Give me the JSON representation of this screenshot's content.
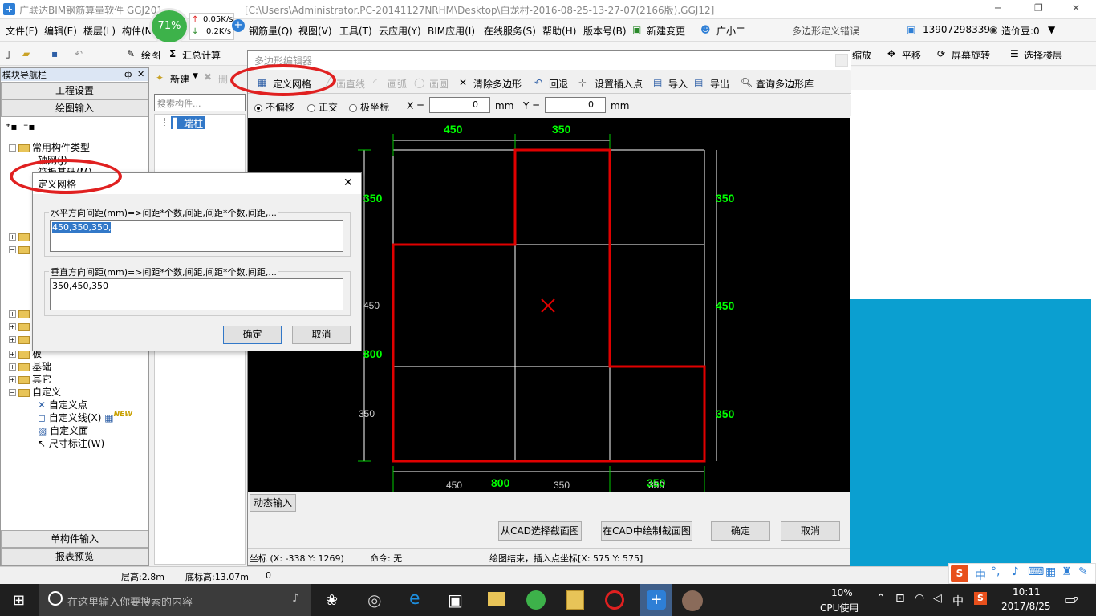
{
  "window": {
    "title": "广联达BIM钢筋算量软件 GGJ2013 - [C:\\Users\\Administrator.PC-20141127NRHM\\Desktop\\白龙村-2016-08-25-13-27-07(2166版).GGJ12]",
    "title_prefix": "广联达BIM钢筋算量软件 GGJ201",
    "title_suffix": "[C:\\Users\\Administrator.PC-20141127NRHM\\Desktop\\白龙村-2016-08-25-13-27-07(2166版).GGJ12]",
    "minimize": "─",
    "restore": "❐",
    "close": "✕"
  },
  "net_widget": {
    "percent": "71%",
    "up": "0.05K/s",
    "down": "0.2K/s"
  },
  "menu": {
    "file": "文件(F)",
    "edit": "编辑(E)",
    "floor": "楼层(L)",
    "component": "构件(N",
    "rebar": "钢筋量(Q)",
    "view": "视图(V)",
    "tools": "工具(T)",
    "cloud": "云应用(Y)",
    "bim": "BIM应用(I)",
    "online": "在线服务(S)",
    "help": "帮助(H)",
    "version": "版本号(B)",
    "new_change": "新建变更",
    "assistant": "广小二",
    "error_label": "多边形定义错误",
    "phone": "13907298339",
    "price": "造价豆:0"
  },
  "toolbar": {
    "draw": "绘图",
    "sum": "汇总计算",
    "zoom": "缩放",
    "pan": "平移",
    "rotate": "屏幕旋转",
    "select_floor": "选择楼层"
  },
  "nav": {
    "header": "模块导航栏",
    "pin": "ф",
    "close": "✕",
    "project_settings": "工程设置",
    "draw_input": "绘图输入",
    "tree": {
      "common_types": "常用构件类型",
      "item_a": "轴网(J)",
      "item_b": "筏板基础(M)",
      "plate": "板",
      "foundation": "基础",
      "other": "其它",
      "custom": "自定义",
      "custom_point": "自定义点",
      "custom_line": "自定义线(X)",
      "new_badge": "NEW",
      "custom_face": "自定义面",
      "dimension": "尺寸标注(W)"
    },
    "single_input": "单构件输入",
    "report_preview": "报表预览"
  },
  "mid": {
    "new": "新建",
    "delete": "删",
    "search_placeholder": "搜索构件...",
    "selected_item": "端柱"
  },
  "editor": {
    "title": "多边形编辑器",
    "tools": {
      "define_grid": "定义网格",
      "draw_line": "画直线",
      "draw_arc": "画弧",
      "draw_circle": "画圆",
      "clear_polygon": "清除多边形",
      "undo": "回退",
      "set_insert_point": "设置插入点",
      "import": "导入",
      "export": "导出",
      "query_library": "查询多边形库"
    },
    "options": {
      "no_offset": "不偏移",
      "orthogonal": "正交",
      "polar": "极坐标",
      "x_label": "X =",
      "x_value": "0",
      "y_label": "Y =",
      "y_value": "0",
      "unit": "mm"
    },
    "dims": {
      "top_450": "450",
      "top_350": "350",
      "left_350": "350",
      "left_450": "450",
      "left_800": "800",
      "left_350b": "350",
      "right_350": "350",
      "right_450": "450",
      "right_350b": "350",
      "bottom_450": "450",
      "bottom_800": "800",
      "bottom_350": "350",
      "bottom_350g": "350",
      "bottom_350w": "350"
    },
    "dynamic_input": "动态输入",
    "btn_select_cad": "从CAD选择截面图",
    "btn_draw_cad": "在CAD中绘制截面图",
    "btn_ok": "确定",
    "btn_cancel": "取消",
    "status": {
      "coords": "坐标 (X: -338 Y: 1269)",
      "command": "命令: 无",
      "message": "绘图结束，插入点坐标[X: 575 Y: 575]"
    }
  },
  "dialog": {
    "title": "定义网格",
    "close": "✕",
    "horizontal_label": "水平方向间距(mm)=>间距*个数,间距,间距*个数,间距,...",
    "horizontal_value": "450,350,350,",
    "vertical_label": "垂直方向间距(mm)=>间距*个数,间距,间距*个数,间距,...",
    "vertical_value": "350,450,350",
    "ok": "确定",
    "cancel": "取消"
  },
  "statusbar": {
    "floor_height": "层高:2.8m",
    "bottom_elev": "底标高:13.07m",
    "zero": "0"
  },
  "taskbar": {
    "search_placeholder": "在这里输入你要搜索的内容",
    "cpu_percent": "10%",
    "cpu_label": "CPU使用",
    "ime": "中",
    "time": "10:11",
    "date": "2017/8/25",
    "notifications": "2"
  },
  "ime_bar": {
    "mode": "中"
  },
  "colors": {
    "polygon": "#e00000",
    "dim_green": "#00ff00",
    "annotation_circle": "#e02020",
    "blue_panel": "#0b9fd0"
  }
}
